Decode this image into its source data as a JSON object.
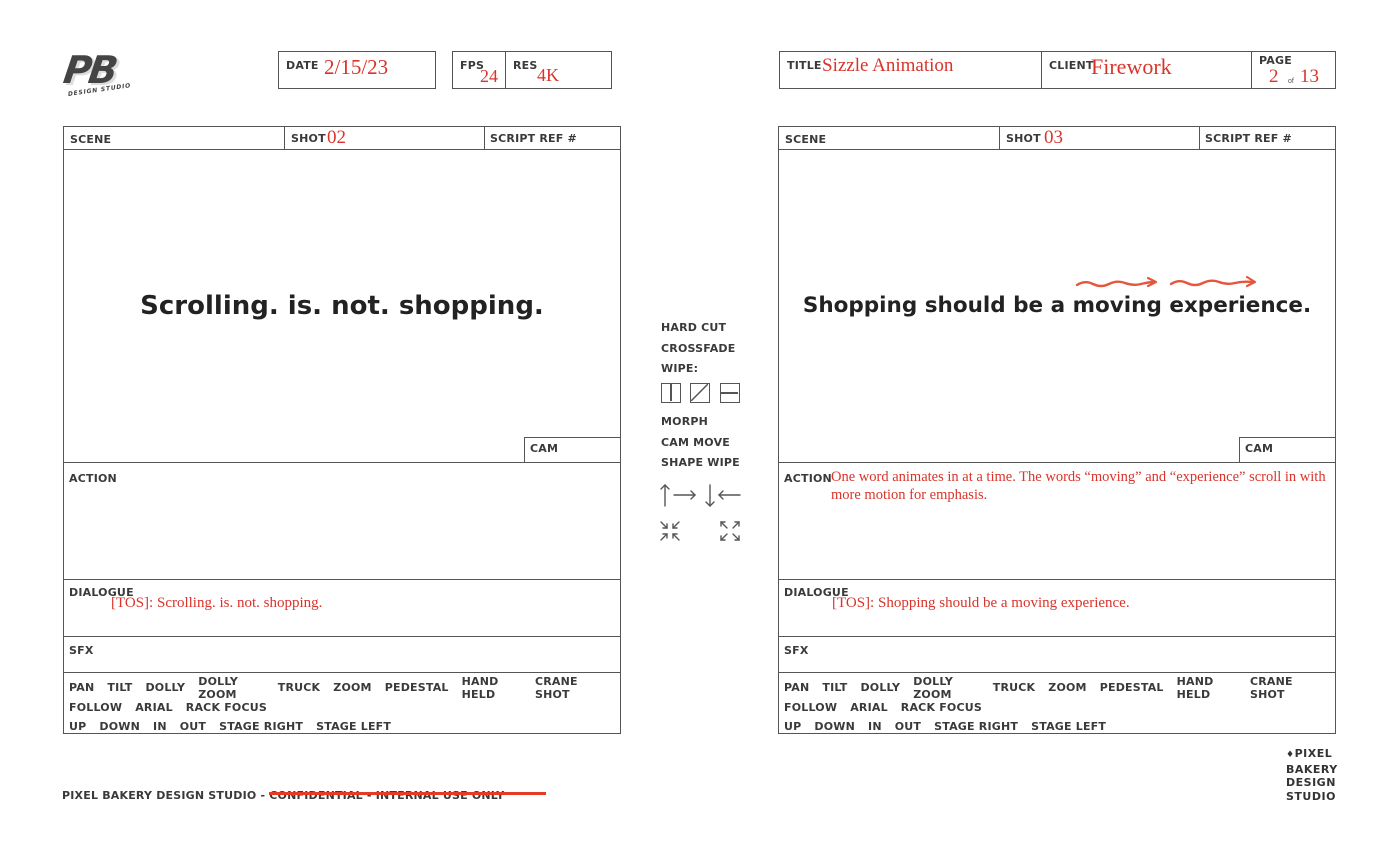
{
  "logo": {
    "mark": "PB",
    "sub": "DESIGN STUDIO"
  },
  "header": {
    "date_label": "DATE",
    "date_value": "2/15/23",
    "fps_label": "FPS",
    "fps_value": "24",
    "res_label": "RES",
    "res_value": "4K",
    "title_label": "TITLE",
    "title_value": "Sizzle Animation",
    "client_label": "CLIENT",
    "client_value": "Firework",
    "page_label": "PAGE",
    "page_value": "2",
    "page_of": "of",
    "page_total": "13"
  },
  "labels": {
    "scene": "SCENE",
    "shot": "SHOT",
    "script_ref": "SCRIPT REF #",
    "cam": "CAM",
    "action": "ACTION",
    "dialogue": "DIALOGUE",
    "sfx": "SFX"
  },
  "camera_moves": [
    [
      "PAN",
      "TILT",
      "DOLLY",
      "DOLLY ZOOM",
      "TRUCK",
      "ZOOM",
      "PEDESTAL",
      "HAND HELD",
      "CRANE SHOT"
    ],
    [
      "FOLLOW",
      "ARIAL",
      "RACK FOCUS"
    ],
    [
      "UP",
      "DOWN",
      "IN",
      "OUT",
      "STAGE RIGHT",
      "STAGE LEFT"
    ]
  ],
  "panels": [
    {
      "shot": "02",
      "frame_text": "Scrolling. is. not. shopping.",
      "action": "",
      "dialogue": "[TOS]: Scrolling. is. not. shopping."
    },
    {
      "shot": "03",
      "frame_text": "Shopping should be a moving experience.",
      "action": "One word animates in at a time. The words “moving” and “experience” scroll in with more motion for emphasis.",
      "dialogue": "[TOS]: Shopping should be a moving experience."
    }
  ],
  "transitions": {
    "hard_cut": "HARD CUT",
    "crossfade": "CROSSFADE",
    "wipe": "WIPE:",
    "morph": "MORPH",
    "cam_move": "CAM MOVE",
    "shape_wipe": "SHAPE WIPE"
  },
  "footer": {
    "prefix": "PIXEL BAKERY DESIGN STUDIO - ",
    "struck": "CONFIDENTIAL - INTERNAL USE ONLY"
  },
  "studio_mark": [
    "PIXEL",
    "BAKERY",
    "DESIGN",
    "STUDIO"
  ],
  "colors": {
    "annotation": "#d9342b",
    "ink": "#555555"
  }
}
